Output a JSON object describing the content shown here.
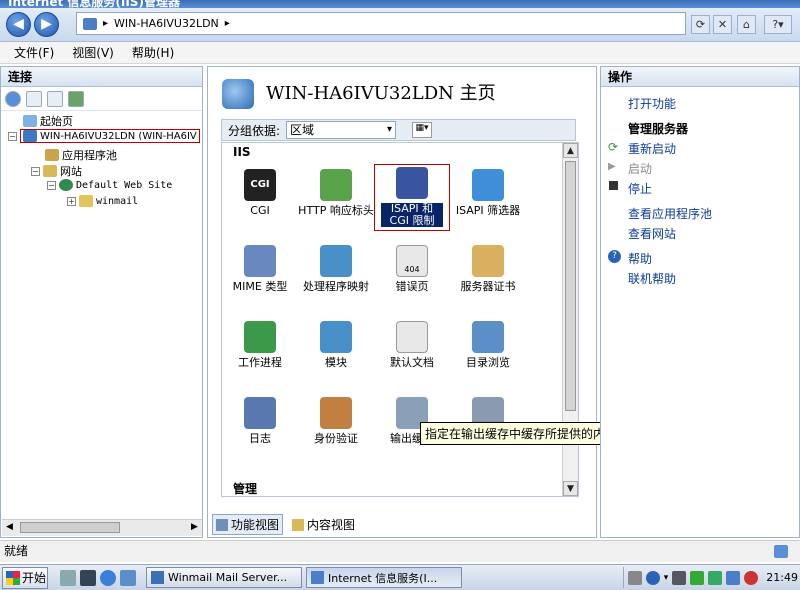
{
  "window": {
    "title": "Internet 信息服务(IIS)管理器"
  },
  "address": {
    "crumb": "WIN-HA6IVU32LDN",
    "sep": "▸"
  },
  "menu": [
    "文件(F)",
    "视图(V)",
    "帮助(H)"
  ],
  "connections": {
    "title": "连接",
    "tree": [
      {
        "label": "起始页"
      },
      {
        "label": "WIN-HA6IVU32LDN (WIN-HA6IV"
      },
      {
        "label": "应用程序池"
      },
      {
        "label": "网站"
      },
      {
        "label": "Default Web Site"
      },
      {
        "label": "winmail"
      }
    ]
  },
  "center": {
    "title": "WIN-HA6IVU32LDN 主页",
    "group_label": "分组依据:",
    "group_value": "区域",
    "section_iis": "IIS",
    "section_mgmt": "管理",
    "features": [
      {
        "label": "CGI",
        "icon": "cgi-icon"
      },
      {
        "label": "HTTP 响应标头",
        "icon": "http-headers-icon"
      },
      {
        "label": "ISAPI 和 CGI 限制",
        "icon": "isapi-cgi-icon"
      },
      {
        "label": "ISAPI 筛选器",
        "icon": "isapi-filter-icon"
      },
      {
        "label": "MIME 类型",
        "icon": "mime-icon"
      },
      {
        "label": "处理程序映射",
        "icon": "handler-icon"
      },
      {
        "label": "错误页",
        "icon": "error-page-icon"
      },
      {
        "label": "服务器证书",
        "icon": "certificate-icon"
      },
      {
        "label": "工作进程",
        "icon": "worker-process-icon"
      },
      {
        "label": "模块",
        "icon": "modules-icon"
      },
      {
        "label": "默认文档",
        "icon": "default-doc-icon"
      },
      {
        "label": "目录浏览",
        "icon": "dir-browse-icon"
      },
      {
        "label": "日志",
        "icon": "logging-icon"
      },
      {
        "label": "身份验证",
        "icon": "auth-icon"
      },
      {
        "label": "输出缓存",
        "icon": "output-cache-icon"
      },
      {
        "label": "",
        "icon": "compression-icon"
      }
    ],
    "tooltip": "指定在输出缓存中缓存所提供的内容的规则",
    "tabs": {
      "features": "功能视图",
      "content": "内容视图"
    }
  },
  "actions": {
    "title": "操作",
    "open_feature": "打开功能",
    "manage_server": "管理服务器",
    "restart": "重新启动",
    "start": "启动",
    "stop": "停止",
    "view_pools": "查看应用程序池",
    "view_sites": "查看网站",
    "help": "帮助",
    "online_help": "联机帮助"
  },
  "status": {
    "text": "就绪"
  },
  "taskbar": {
    "start": "开始",
    "tasks": [
      "Winmail Mail Server...",
      "Internet 信息服务(I..."
    ],
    "clock": "21:49"
  }
}
